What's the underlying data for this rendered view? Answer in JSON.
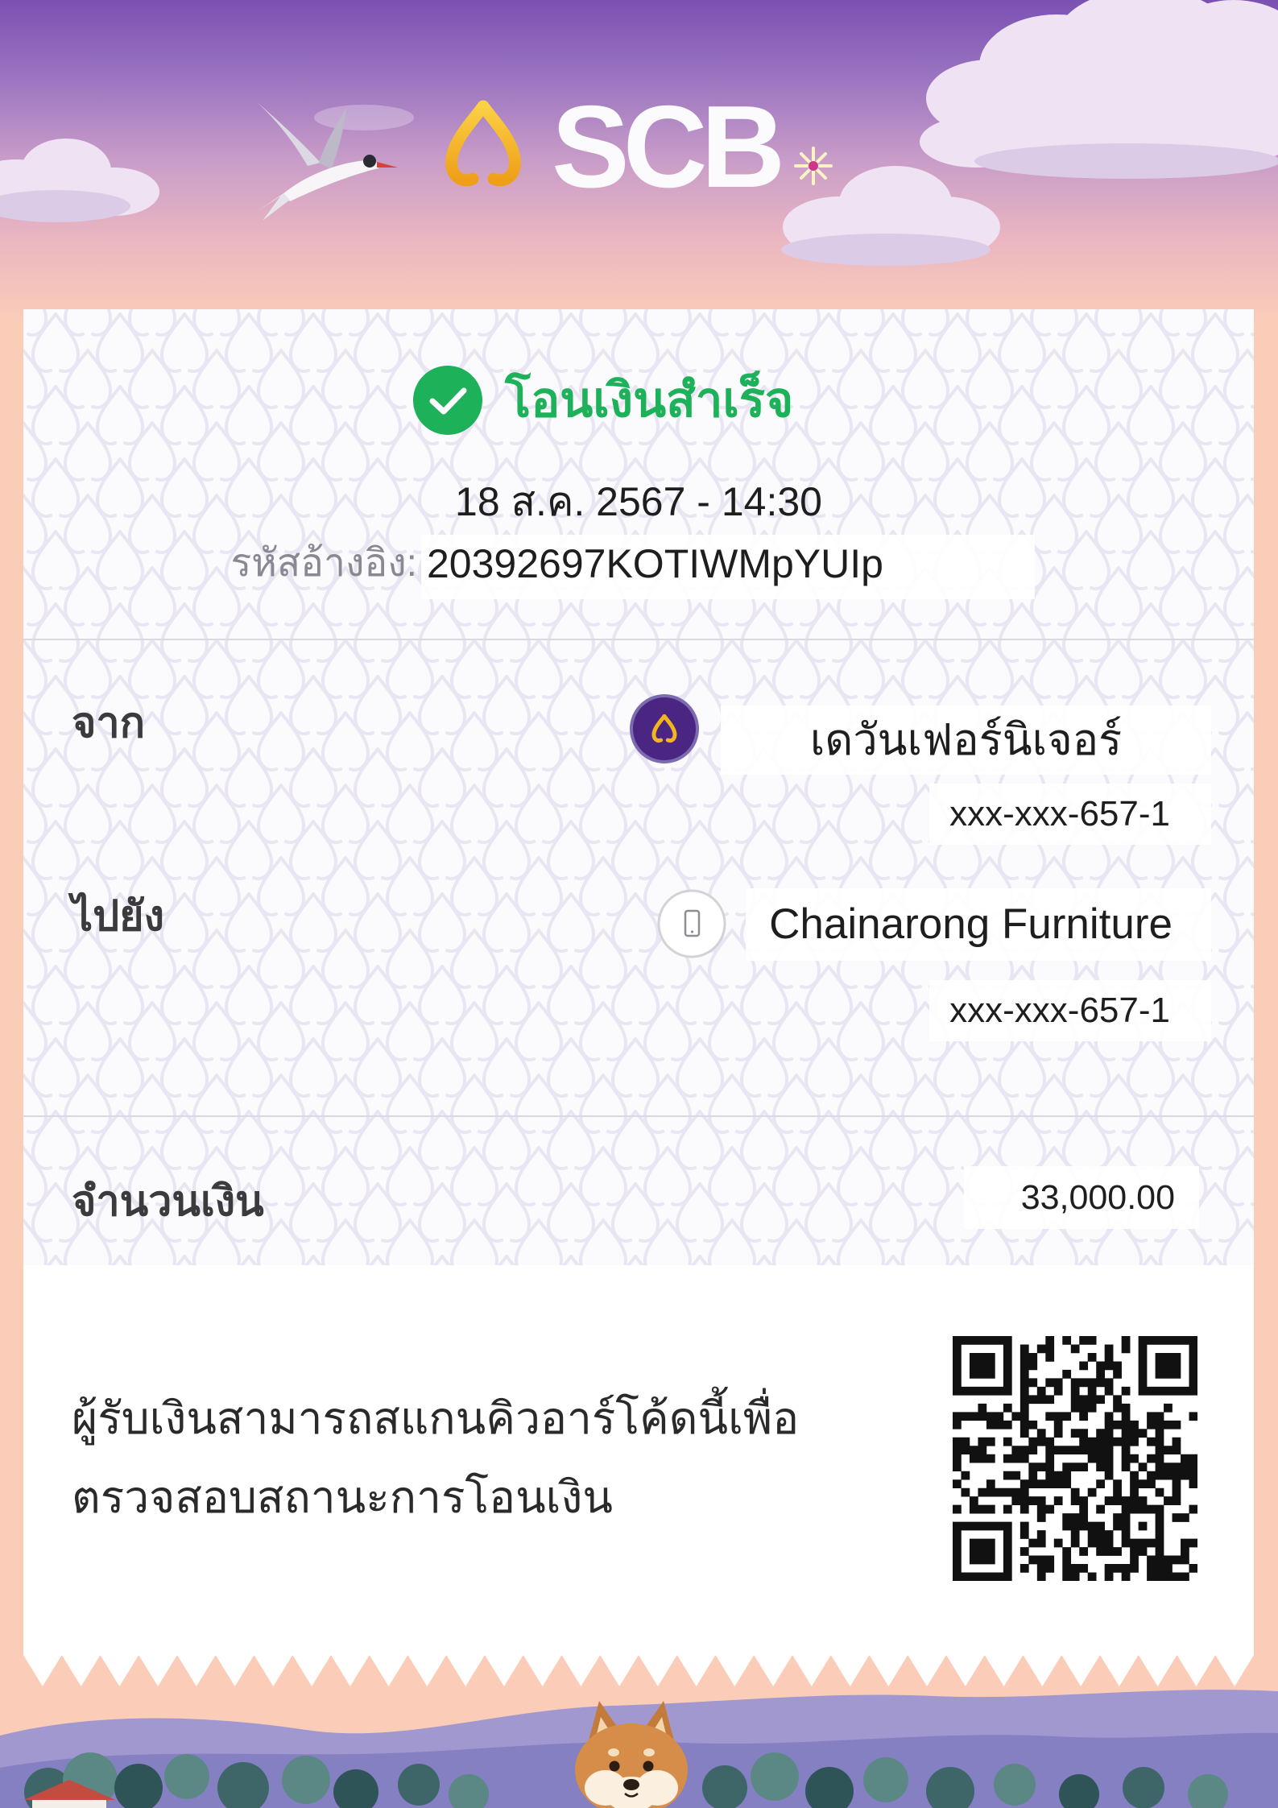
{
  "header": {
    "brand": "SCB",
    "logo_icon": "scb-bell-logo-icon"
  },
  "status": {
    "icon": "check-circle-icon",
    "text": "โอนเงินสำเร็จ"
  },
  "transaction": {
    "datetime": "18 ส.ค. 2567 - 14:30",
    "reference_label": "รหัสอ้างอิง:",
    "reference_value": "20392697KOTIWMpYUIp"
  },
  "from": {
    "label": "จาก",
    "icon": "scb-bank-icon",
    "name": "เดวันเฟอร์นิเจอร์",
    "account": "xxx-xxx-657-1"
  },
  "to": {
    "label": "ไปยัง",
    "icon": "mobile-phone-icon",
    "name": "Chainarong Furniture",
    "account": "xxx-xxx-657-1"
  },
  "amount": {
    "label": "จำนวนเงิน",
    "value": "33,000.00"
  },
  "verification": {
    "icon": "qr-code-icon",
    "caption": [
      "ผู้รับเงินสามารถสแกนคิวอาร์โค้ดนี้เพื่อ",
      "ตรวจสอบสถานะการโอนเงิน"
    ]
  },
  "colors": {
    "success_green": "#1db15a",
    "scb_purple": "#4a2581",
    "scb_gold": "#f4b41f",
    "header_purple": "#7a51b2",
    "background_peach": "#fbcdb8",
    "label_gray": "#8a8893",
    "text_dark": "#1e1e1e"
  }
}
